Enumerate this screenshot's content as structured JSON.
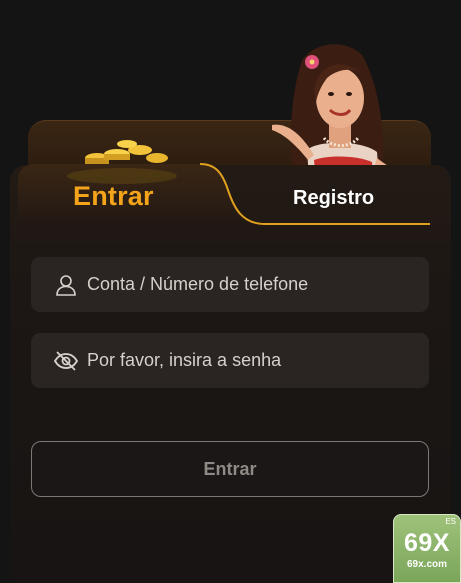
{
  "tabs": {
    "login_label": "Entrar",
    "register_label": "Registro",
    "active": "Entrar"
  },
  "form": {
    "account_placeholder": "Conta / Número de telefone",
    "account_value": "",
    "password_placeholder": "Por favor, insira a senha",
    "password_value": "",
    "submit_label": "Entrar"
  },
  "icons": {
    "account": "user-icon",
    "password": "eye-off-icon"
  },
  "colors": {
    "accent": "#f4a41a",
    "background": "#141414",
    "input_bg": "#2a2522"
  },
  "watermark": {
    "brand": "69X",
    "domain": "69x.com",
    "badge": "ES"
  }
}
